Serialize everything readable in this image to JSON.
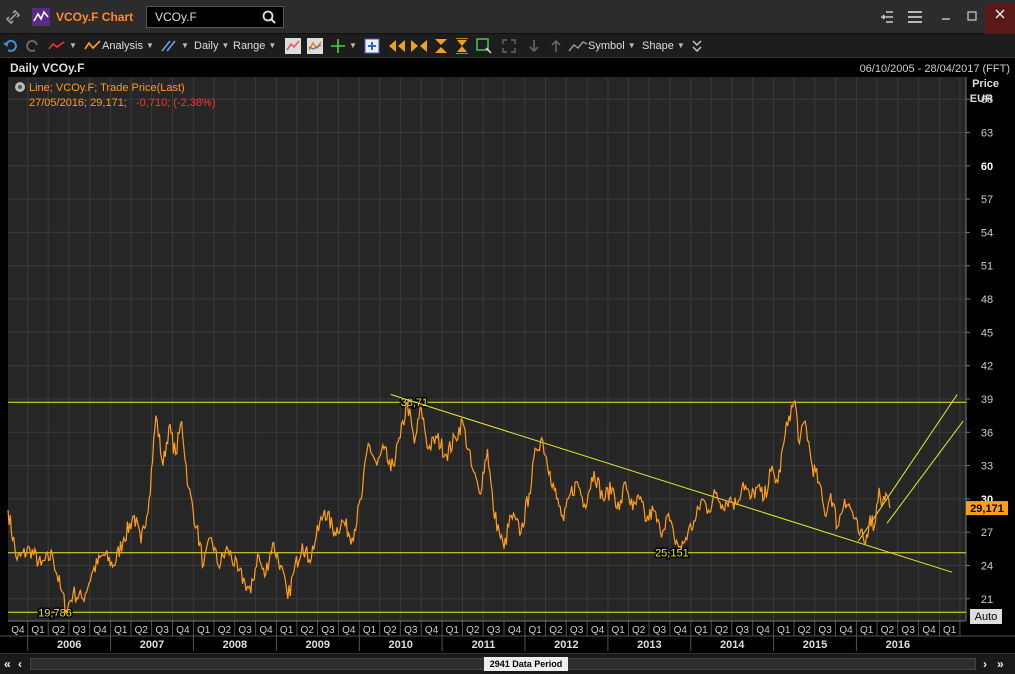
{
  "window": {
    "title": "VCOy.F Chart",
    "ric_value": "VCOy.F"
  },
  "toolbar": {
    "analysis_label": "Analysis",
    "interval_label": "Daily",
    "range_label": "Range",
    "symbol_label": "Symbol",
    "shape_label": "Shape"
  },
  "chart_header": {
    "title": "Daily VCOy.F",
    "date_range": "06/10/2005 - 28/04/2017 (FFT)",
    "legend_line1": "Line; VCOy.F; Trade Price(Last)",
    "legend_date": "27/05/2016; 29,171;",
    "legend_change": "-0,710; (-2,38%)"
  },
  "chart_data": {
    "type": "line",
    "series": [
      {
        "color": "#ff9d1c",
        "points": [
          [
            "2005-10-06",
            29.0
          ],
          [
            "2005-11-15",
            24.5
          ],
          [
            "2006-01-10",
            25.5
          ],
          [
            "2006-03-01",
            24.0
          ],
          [
            "2006-04-20",
            25.0
          ],
          [
            "2006-05-25",
            22.0
          ],
          [
            "2006-06-20",
            20.0
          ],
          [
            "2006-07-20",
            21.5
          ],
          [
            "2006-09-01",
            21.0
          ],
          [
            "2006-10-15",
            23.5
          ],
          [
            "2006-12-01",
            25.0
          ],
          [
            "2007-01-15",
            24.0
          ],
          [
            "2007-03-01",
            26.5
          ],
          [
            "2007-04-15",
            28.5
          ],
          [
            "2007-05-15",
            26.0
          ],
          [
            "2007-06-20",
            30.0
          ],
          [
            "2007-07-20",
            37.5
          ],
          [
            "2007-08-20",
            33.0
          ],
          [
            "2007-09-15",
            36.5
          ],
          [
            "2007-10-15",
            34.0
          ],
          [
            "2007-11-10",
            37.0
          ],
          [
            "2007-12-10",
            31.0
          ],
          [
            "2008-01-15",
            27.5
          ],
          [
            "2008-02-15",
            24.0
          ],
          [
            "2008-03-20",
            26.5
          ],
          [
            "2008-04-20",
            24.0
          ],
          [
            "2008-06-01",
            25.5
          ],
          [
            "2008-07-15",
            23.5
          ],
          [
            "2008-08-15",
            22.5
          ],
          [
            "2008-09-10",
            21.5
          ],
          [
            "2008-10-10",
            25.0
          ],
          [
            "2008-11-10",
            23.0
          ],
          [
            "2008-12-15",
            26.0
          ],
          [
            "2009-01-20",
            24.0
          ],
          [
            "2009-02-20",
            21.0
          ],
          [
            "2009-03-20",
            23.5
          ],
          [
            "2009-04-25",
            26.0
          ],
          [
            "2009-05-25",
            24.5
          ],
          [
            "2009-06-25",
            26.5
          ],
          [
            "2009-08-01",
            29.0
          ],
          [
            "2009-09-15",
            27.0
          ],
          [
            "2009-10-20",
            28.0
          ],
          [
            "2009-12-01",
            26.5
          ],
          [
            "2010-01-10",
            30.0
          ],
          [
            "2010-02-10",
            35.0
          ],
          [
            "2010-03-20",
            33.0
          ],
          [
            "2010-04-20",
            34.5
          ],
          [
            "2010-05-20",
            32.5
          ],
          [
            "2010-07-01",
            35.5
          ],
          [
            "2010-08-01",
            38.7
          ],
          [
            "2010-09-01",
            35.0
          ],
          [
            "2010-10-01",
            38.2
          ],
          [
            "2010-11-01",
            34.5
          ],
          [
            "2010-12-10",
            35.5
          ],
          [
            "2011-01-20",
            34.0
          ],
          [
            "2011-03-01",
            35.5
          ],
          [
            "2011-04-01",
            37.0
          ],
          [
            "2011-05-10",
            33.0
          ],
          [
            "2011-06-15",
            30.5
          ],
          [
            "2011-07-20",
            34.5
          ],
          [
            "2011-08-15",
            29.0
          ],
          [
            "2011-09-10",
            27.0
          ],
          [
            "2011-10-01",
            25.5
          ],
          [
            "2011-11-01",
            28.5
          ],
          [
            "2011-12-15",
            27.0
          ],
          [
            "2012-01-20",
            30.5
          ],
          [
            "2012-02-20",
            34.5
          ],
          [
            "2012-03-15",
            35.5
          ],
          [
            "2012-04-20",
            32.5
          ],
          [
            "2012-05-20",
            30.0
          ],
          [
            "2012-06-20",
            28.0
          ],
          [
            "2012-07-20",
            30.5
          ],
          [
            "2012-08-20",
            31.5
          ],
          [
            "2012-09-20",
            29.5
          ],
          [
            "2012-11-01",
            32.5
          ],
          [
            "2012-12-10",
            30.0
          ],
          [
            "2013-01-20",
            31.0
          ],
          [
            "2013-02-20",
            29.0
          ],
          [
            "2013-03-20",
            31.5
          ],
          [
            "2013-04-20",
            29.0
          ],
          [
            "2013-05-20",
            30.0
          ],
          [
            "2013-06-20",
            28.0
          ],
          [
            "2013-07-20",
            29.0
          ],
          [
            "2013-08-20",
            27.0
          ],
          [
            "2013-09-20",
            28.5
          ],
          [
            "2013-10-20",
            26.5
          ],
          [
            "2013-11-20",
            25.5
          ],
          [
            "2013-12-20",
            27.0
          ],
          [
            "2014-01-20",
            28.0
          ],
          [
            "2014-02-20",
            30.0
          ],
          [
            "2014-03-20",
            29.0
          ],
          [
            "2014-04-20",
            30.5
          ],
          [
            "2014-05-20",
            29.5
          ],
          [
            "2014-06-20",
            30.0
          ],
          [
            "2014-07-20",
            29.5
          ],
          [
            "2014-08-20",
            31.5
          ],
          [
            "2014-09-20",
            30.0
          ],
          [
            "2014-10-20",
            31.0
          ],
          [
            "2014-11-20",
            30.0
          ],
          [
            "2014-12-20",
            32.5
          ],
          [
            "2015-01-20",
            31.5
          ],
          [
            "2015-02-15",
            35.0
          ],
          [
            "2015-03-10",
            37.5
          ],
          [
            "2015-04-05",
            38.8
          ],
          [
            "2015-04-25",
            35.0
          ],
          [
            "2015-05-20",
            37.0
          ],
          [
            "2015-06-20",
            33.0
          ],
          [
            "2015-07-20",
            31.5
          ],
          [
            "2015-08-15",
            28.5
          ],
          [
            "2015-09-10",
            30.5
          ],
          [
            "2015-10-10",
            27.5
          ],
          [
            "2015-11-10",
            30.0
          ],
          [
            "2015-12-10",
            29.0
          ],
          [
            "2016-01-10",
            27.0
          ],
          [
            "2016-02-10",
            26.0
          ],
          [
            "2016-03-01",
            28.5
          ],
          [
            "2016-03-20",
            27.5
          ],
          [
            "2016-04-10",
            31.0
          ],
          [
            "2016-04-25",
            29.5
          ],
          [
            "2016-05-10",
            30.5
          ],
          [
            "2016-05-27",
            29.171
          ]
        ]
      }
    ],
    "yaxis_label": "Price",
    "yaxis_unit": "EUR",
    "ylim": [
      19,
      68
    ],
    "y_ticks": [
      21,
      24,
      27,
      30,
      33,
      36,
      39,
      42,
      45,
      48,
      51,
      54,
      57,
      60,
      63,
      66
    ],
    "xlim": [
      "2005-10-06",
      "2017-04-28"
    ],
    "years": [
      "2006",
      "2007",
      "2008",
      "2009",
      "2010",
      "2011",
      "2012",
      "2013",
      "2014",
      "2015",
      "2016"
    ],
    "quarters": [
      "Q1",
      "Q2",
      "Q3",
      "Q4"
    ],
    "last_value_label": "29,171",
    "horizontal_lines": [
      {
        "y": 38.71,
        "label": "38,71",
        "label_date": "2010-09-01"
      },
      {
        "y": 25.151,
        "label": "25,151",
        "label_date": "2013-10-10"
      },
      {
        "y": 19.786,
        "label": "19,786",
        "label_date": "2006-05-01"
      }
    ],
    "trendlines": [
      {
        "from": [
          "2010-05-20",
          39.4
        ],
        "to": [
          "2017-02-25",
          23.4
        ]
      },
      {
        "from": [
          "2016-01-10",
          26.2
        ],
        "to": [
          "2017-03-20",
          39.4
        ]
      },
      {
        "from": [
          "2016-05-15",
          27.8
        ],
        "to": [
          "2017-04-15",
          37.0
        ]
      }
    ],
    "grid": true,
    "scroll_label": "2941 Data Period",
    "auto_label": "Auto"
  }
}
